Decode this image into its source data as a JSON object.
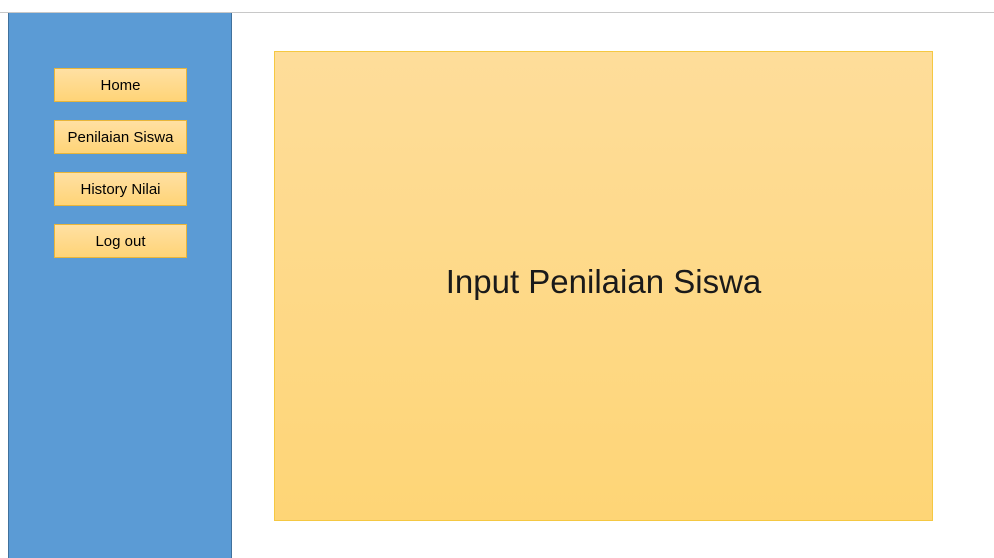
{
  "sidebar": {
    "items": [
      {
        "label": "Home"
      },
      {
        "label": "Penilaian Siswa"
      },
      {
        "label": "History Nilai"
      },
      {
        "label": "Log out"
      }
    ]
  },
  "main": {
    "title": "Input Penilaian Siswa"
  },
  "colors": {
    "sidebar_bg": "#5b9bd5",
    "button_bg": "#ffd98a",
    "panel_bg": "#fed886"
  }
}
